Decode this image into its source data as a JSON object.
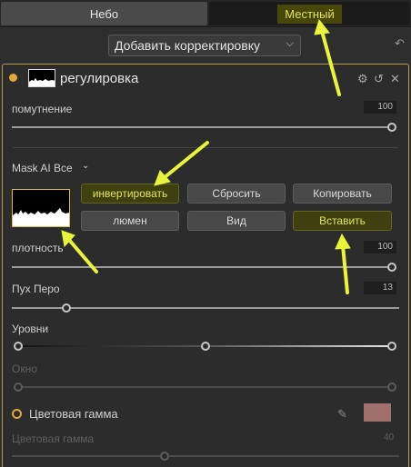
{
  "tabs": {
    "sky": "Небо",
    "local": "Местный"
  },
  "toolbar": {
    "add_adjustment": "Добавить корректировку",
    "chevron_icon": "chevron-down-icon",
    "undo_icon": "undo-icon"
  },
  "panel": {
    "title": "регулировка",
    "active_dot_color": "#e0a83a",
    "border_color": "#b89a4c"
  },
  "controls": {
    "opacity": {
      "label": "помутнение",
      "value": "100",
      "level": 1.0
    },
    "mask_ai": {
      "label": "Mask AI",
      "mode": "Все"
    },
    "buttons": {
      "invert": "инвертировать",
      "reset": "Сбросить",
      "copy": "Копировать",
      "lumen": "люмен",
      "view": "Вид",
      "paste": "Вставить"
    },
    "density": {
      "label": "плотность",
      "value": "100",
      "level": 1.0
    },
    "feather": {
      "label": "Пух Перо",
      "value": "13",
      "level": 0.13
    },
    "levels": {
      "label": "Уровни",
      "black": 0.0,
      "mid": 0.5,
      "white": 1.0
    },
    "window": {
      "label": "Окно"
    },
    "color_range": {
      "label": "Цветовая гамма",
      "swatch_color": "#a0706c"
    },
    "color_range_slider": {
      "label": "Цветовая гамма",
      "value": "40",
      "level": 0.4
    }
  },
  "annotation": {
    "arrow_color": "#e8f53a"
  }
}
